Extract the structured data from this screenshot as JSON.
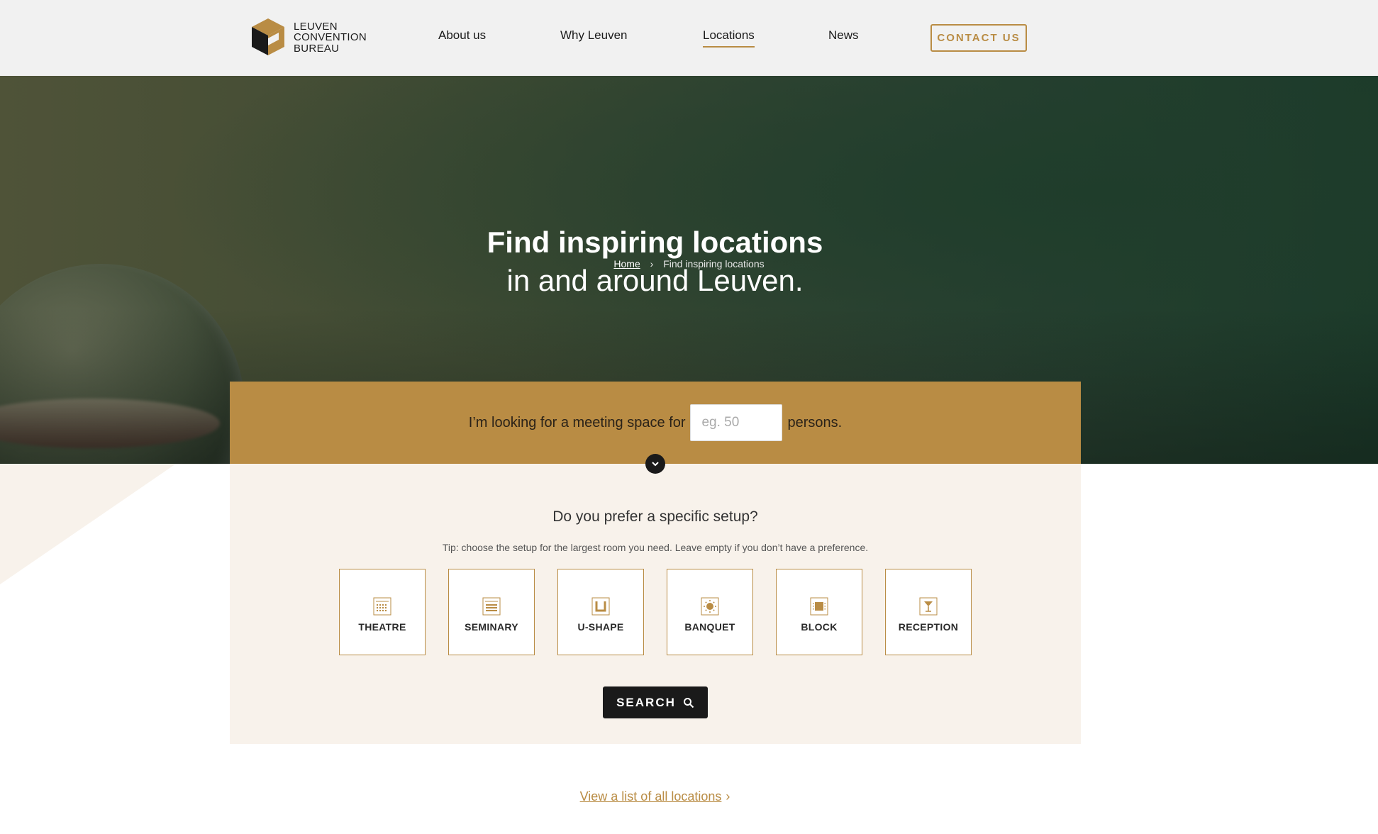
{
  "header": {
    "logo_lines": [
      "LEUVEN",
      "CONVENTION",
      "BUREAU"
    ],
    "nav": [
      {
        "label": "About us",
        "active": false
      },
      {
        "label": "Why Leuven",
        "active": false
      },
      {
        "label": "Locations",
        "active": true
      },
      {
        "label": "News",
        "active": false
      }
    ],
    "contact_label": "CONTACT US"
  },
  "hero": {
    "breadcrumb": {
      "home": "Home",
      "separator": "›",
      "current": "Find inspiring locations"
    },
    "title": "Find inspiring locations",
    "subtitle": "in and around Leuven."
  },
  "search": {
    "prefix": "I’m looking for a meeting space for",
    "placeholder": "eg. 50",
    "value": "",
    "suffix": "persons.",
    "setup_question": "Do you prefer a specific setup?",
    "tip": "Tip: choose the setup for the largest room you need. Leave empty if you don’t have a preference.",
    "setups": [
      {
        "label": "THEATRE",
        "icon": "theatre-icon"
      },
      {
        "label": "SEMINARY",
        "icon": "seminary-icon"
      },
      {
        "label": "U-SHAPE",
        "icon": "u-shape-icon"
      },
      {
        "label": "BANQUET",
        "icon": "banquet-icon"
      },
      {
        "label": "BLOCK",
        "icon": "block-icon"
      },
      {
        "label": "RECEPTION",
        "icon": "reception-icon"
      }
    ],
    "search_label": "SEARCH"
  },
  "footer_link": {
    "label": "View a list of all locations",
    "arrow": "›"
  },
  "colors": {
    "accent": "#b98c44",
    "panel": "#f8f2eb",
    "dark": "#1a1a1a",
    "header_bg": "#f1f1f1"
  }
}
